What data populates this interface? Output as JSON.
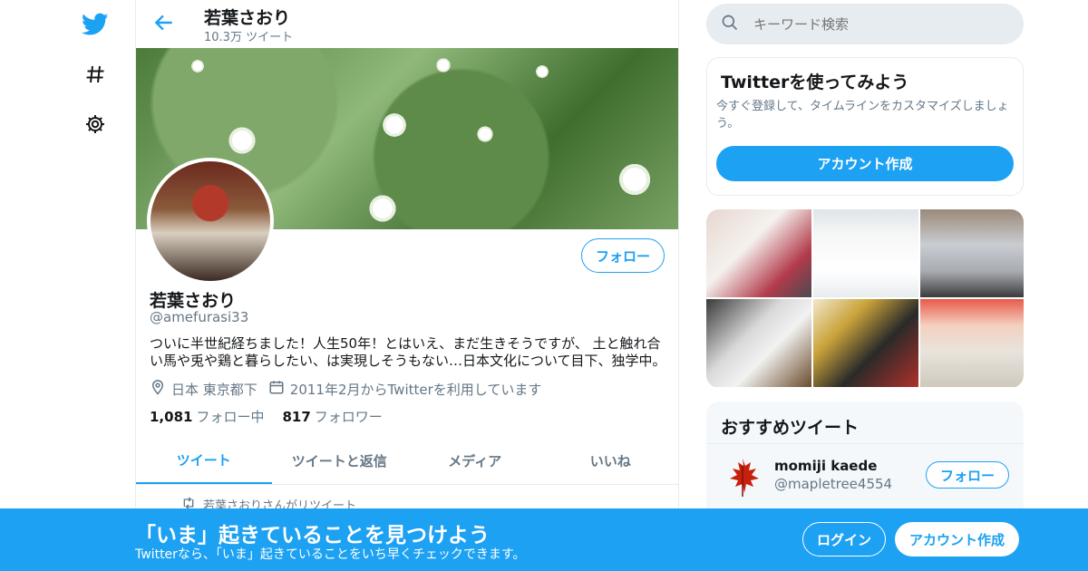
{
  "nav": {
    "icons": [
      "twitter-logo-icon",
      "hashtag-icon",
      "gear-icon"
    ]
  },
  "topbar": {
    "name": "若葉さおり",
    "tweet_count": "10.3万 ツイート"
  },
  "profile": {
    "follow_label": "フォロー",
    "name": "若葉さおり",
    "handle": "@amefurasi33",
    "bio": "ついに半世紀経ちました！人生50年！とはいえ、まだ生きそうですが、 土と触れ合い馬や兎や鶏と暮らしたい、は実現しそうもない…日本文化について目下、独学中。",
    "location": "日本 東京都下",
    "joined": "2011年2月からTwitterを利用しています",
    "following_count": "1,081",
    "following_label": "フォロー中",
    "followers_count": "817",
    "followers_label": "フォロワー"
  },
  "tabs": [
    {
      "label": "ツイート",
      "active": true
    },
    {
      "label": "ツイートと返信",
      "active": false
    },
    {
      "label": "メディア",
      "active": false
    },
    {
      "label": "いいね",
      "active": false
    }
  ],
  "retweet_notice": "若葉さおりさんがリツイート",
  "search": {
    "placeholder": "キーワード検索"
  },
  "signup_card": {
    "title": "Twitterを使ってみよう",
    "description": "今すぐ登録して、タイムラインをカスタマイズしましょう。",
    "button": "アカウント作成"
  },
  "recommended": {
    "title": "おすすめツイート",
    "user_name": "momiji kaede",
    "user_handle": "@mapletree4554",
    "follow_label": "フォロー"
  },
  "bottom_bar": {
    "headline": "「いま」起きていることを見つけよう",
    "subtext": "Twitterなら、「いま」起きていることをいち早くチェックできます。",
    "login": "ログイン",
    "signup": "アカウント作成"
  },
  "colors": {
    "accent": "#1da1f2",
    "muted": "#657786",
    "border": "#e6ecf0"
  }
}
